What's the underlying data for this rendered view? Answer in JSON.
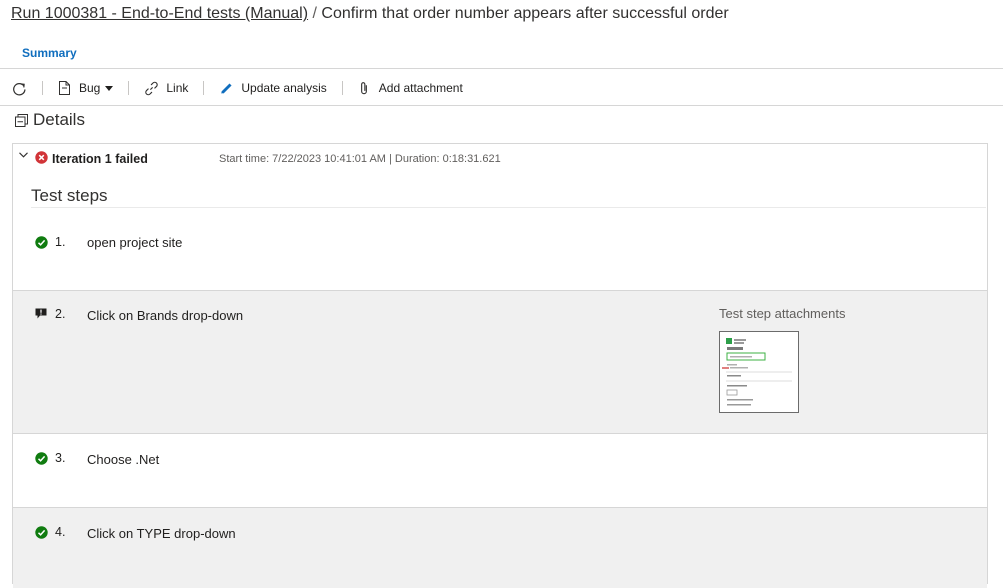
{
  "title": {
    "run_link": "Run 1000381 - End-to-End tests (Manual)",
    "separator": " / ",
    "test_case": "Confirm that order number appears after successful order"
  },
  "tabs": [
    {
      "label": "Summary"
    }
  ],
  "toolbar": {
    "refresh_icon": "refresh-icon",
    "bug_label": "Bug",
    "link_label": "Link",
    "update_analysis_label": "Update analysis",
    "add_attachment_label": "Add attachment"
  },
  "details": {
    "heading": "Details"
  },
  "iteration": {
    "title": "Iteration 1 failed",
    "meta": "Start time: 7/22/2023 10:41:01 AM | Duration: 0:18:31.621",
    "status": "failed"
  },
  "test_steps": {
    "heading": "Test steps",
    "steps": [
      {
        "number": "1.",
        "text": "open project site",
        "status": "passed"
      },
      {
        "number": "2.",
        "text": "Click on Brands drop-down",
        "status": "commented"
      },
      {
        "number": "3.",
        "text": "Choose .Net",
        "status": "passed"
      },
      {
        "number": "4.",
        "text": "Click on TYPE drop-down",
        "status": "passed"
      }
    ],
    "attachments_heading": "Test step attachments"
  },
  "colors": {
    "accent": "#106ebe",
    "fail_red": "#d13438",
    "pass_green": "#107c10",
    "shaded_row": "#f0f0f0"
  }
}
